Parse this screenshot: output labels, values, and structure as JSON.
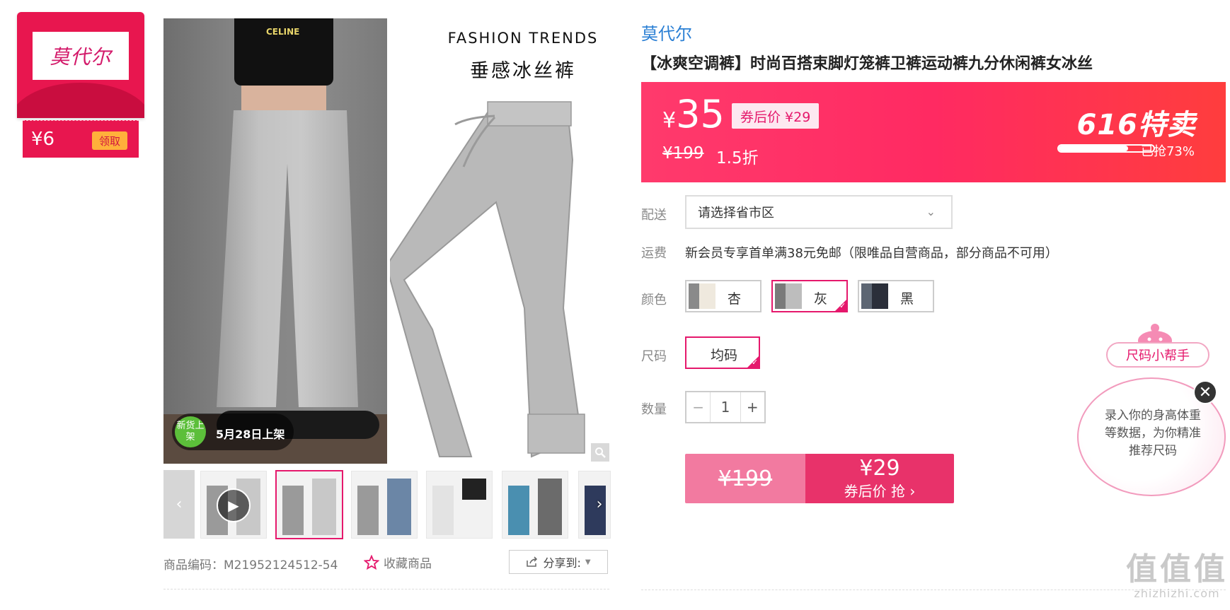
{
  "coupon": {
    "logo_text": "莫代尔",
    "price": "¥6",
    "button": "领取"
  },
  "main_image": {
    "title_en": "FASHION TRENDS",
    "title_cn": "垂感冰丝裤",
    "shirt_text": "CELINE",
    "new_badge_circle": "新货上架",
    "new_badge_text": "5月28日上架"
  },
  "meta": {
    "product_code": "商品编码：M21952124512-54",
    "favorite": "收藏商品",
    "share": "分享到:"
  },
  "product": {
    "brand": "莫代尔",
    "title": "【冰爽空调裤】时尚百搭束脚灯笼裤卫裤运动裤九分休闲裤女冰丝"
  },
  "price_band": {
    "currency": "¥",
    "price": "35",
    "coupon_price": "券后价 ¥29",
    "original_price": "¥199",
    "discount": "1.5折",
    "promo": "616特卖",
    "grabbed_text": "已抢73%",
    "grabbed_fraction": 0.73
  },
  "delivery": {
    "label": "配送",
    "placeholder": "请选择省市区"
  },
  "shipping": {
    "label": "运费",
    "text": "新会员专享首单满38元免邮（限唯品自营商品，部分商品不可用）"
  },
  "color": {
    "label": "颜色",
    "options": [
      {
        "name": "杏",
        "selected": false
      },
      {
        "name": "灰",
        "selected": true
      },
      {
        "name": "黑",
        "selected": false
      }
    ]
  },
  "size": {
    "label": "尺码",
    "options": [
      {
        "name": "均码",
        "selected": true
      }
    ]
  },
  "quantity": {
    "label": "数量",
    "value": "1",
    "minus": "−",
    "plus": "+"
  },
  "buy": {
    "original": "¥199",
    "price": "¥29",
    "action": "券后价 抢 ›"
  },
  "size_helper": {
    "pill": "尺码小帮手",
    "text": "录入你的身高体重等数据，为你精准推荐尺码",
    "close": "✕"
  },
  "watermark": {
    "big": "值值值",
    "url": "zhizhizhi.com"
  },
  "colors": {
    "accent": "#e5186c",
    "brand_link": "#2a7fd4",
    "band": "#ff2a62"
  }
}
